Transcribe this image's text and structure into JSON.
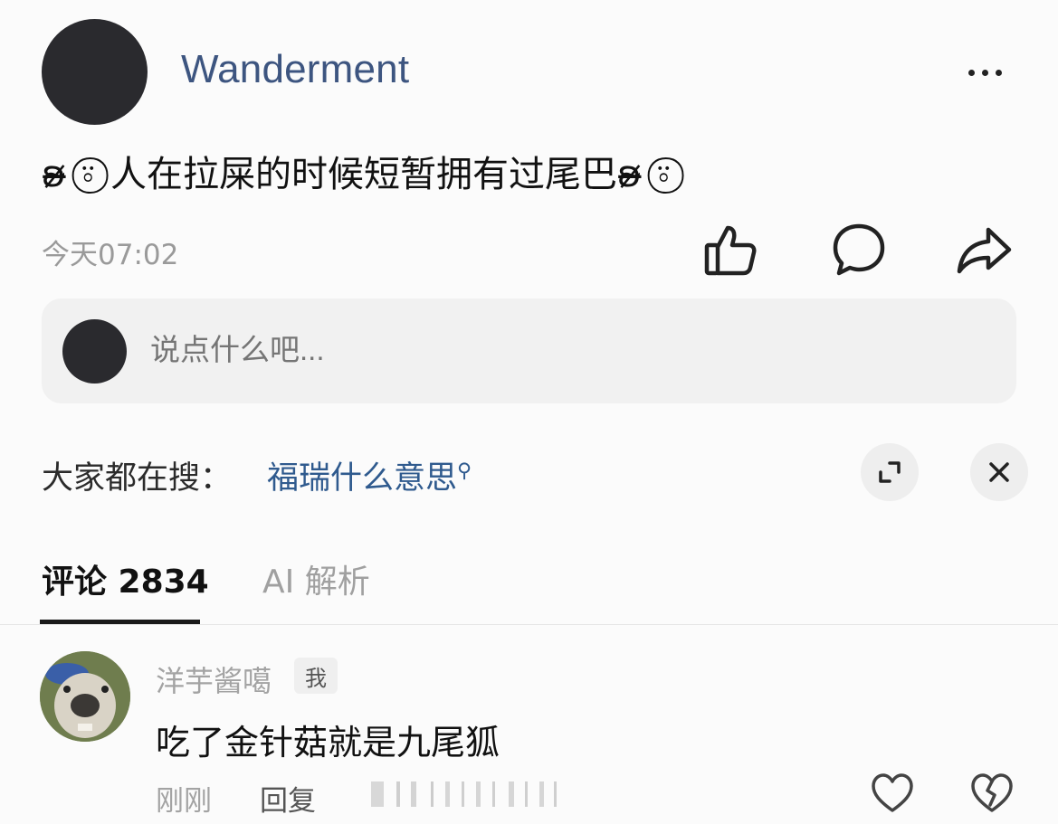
{
  "post": {
    "username": "Wanderment",
    "text": "ʚ̴̶̷̷ ⍤⃝ 人在拉屎的时候短暂拥有过尾巴ʚ̴̶̷̷ ⍤⃝ ",
    "time": "今天07:02"
  },
  "comment_input": {
    "placeholder": "说点什么吧..."
  },
  "search": {
    "label": "大家都在搜：",
    "link": "福瑞什么意思",
    "link_icon": "search-icon"
  },
  "tabs": {
    "comments": "评论 2834",
    "ai": "AI 解析"
  },
  "comment": {
    "username": "洋芋酱噶",
    "badge": "我",
    "text": "吃了金针菇就是九尾狐",
    "time": "刚刚",
    "reply": "回复"
  },
  "colors": {
    "username": "#3d5580",
    "link": "#2f5a8e",
    "muted": "#a3a3a3"
  }
}
